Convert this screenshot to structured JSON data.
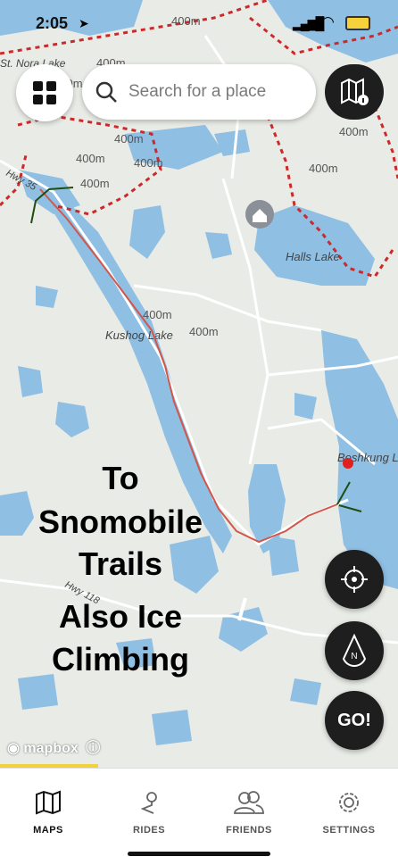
{
  "status": {
    "time": "2:05"
  },
  "search": {
    "placeholder": "Search for a place"
  },
  "map_labels": {
    "hwy35": "Hwy 35",
    "hwy118": "Hwy 118",
    "halls_lake": "Halls Lake",
    "kushog_lake": "Kushog Lake",
    "bushkung": "Boshkung L",
    "st_nora": "St. Nora Lake",
    "elev": "400m"
  },
  "overlay_text": [
    "To",
    "Snomobile",
    "Trails",
    "Also Ice",
    "Climbing"
  ],
  "buttons": {
    "go": "GO!",
    "compass_n": "N"
  },
  "attribution": "mapbox",
  "tabs": [
    {
      "label": "MAPS",
      "icon": "map-icon",
      "active": true
    },
    {
      "label": "RIDES",
      "icon": "route-pin-icon",
      "active": false
    },
    {
      "label": "FRIENDS",
      "icon": "friends-icon",
      "active": false
    },
    {
      "label": "SETTINGS",
      "icon": "gear-icon",
      "active": false
    }
  ],
  "colors": {
    "water": "#8fbfe3",
    "land": "#e9ebe6",
    "boundary": "#cc2a2a",
    "route": "#d2564a",
    "active_tab": "#111111",
    "inactive_tab": "#555555"
  }
}
